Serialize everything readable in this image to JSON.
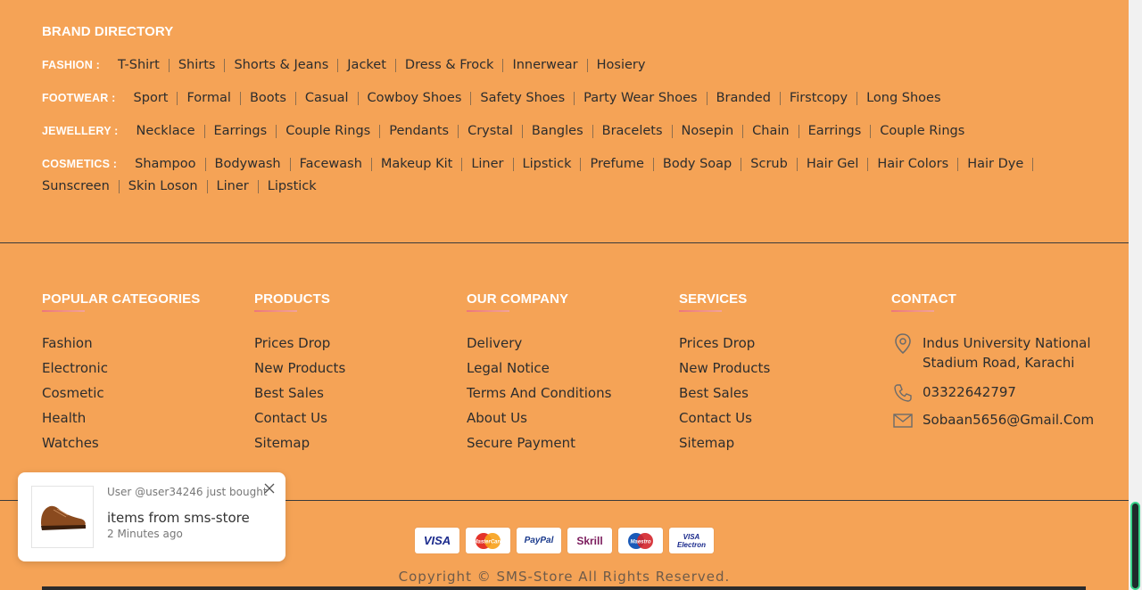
{
  "brand_directory": {
    "title": "BRAND DIRECTORY",
    "rows": [
      {
        "label": "FASHION :",
        "links": [
          "T-Shirt",
          "Shirts",
          "Shorts & Jeans",
          "Jacket",
          "Dress & Frock",
          "Innerwear",
          "Hosiery"
        ]
      },
      {
        "label": "FOOTWEAR :",
        "links": [
          "Sport",
          "Formal",
          "Boots",
          "Casual",
          "Cowboy Shoes",
          "Safety Shoes",
          "Party Wear Shoes",
          "Branded",
          "Firstcopy",
          "Long Shoes"
        ]
      },
      {
        "label": "JEWELLERY :",
        "links": [
          "Necklace",
          "Earrings",
          "Couple Rings",
          "Pendants",
          "Crystal",
          "Bangles",
          "Bracelets",
          "Nosepin",
          "Chain",
          "Earrings",
          "Couple Rings"
        ]
      },
      {
        "label": "COSMETICS :",
        "links": [
          "Shampoo",
          "Bodywash",
          "Facewash",
          "Makeup Kit",
          "Liner",
          "Lipstick",
          "Prefume",
          "Body Soap",
          "Scrub",
          "Hair Gel",
          "Hair Colors",
          "Hair Dye",
          "Sunscreen",
          "Skin Loson",
          "Liner",
          "Lipstick"
        ]
      }
    ]
  },
  "columns": [
    {
      "title": "POPULAR CATEGORIES",
      "items": [
        "Fashion",
        "Electronic",
        "Cosmetic",
        "Health",
        "Watches"
      ]
    },
    {
      "title": "PRODUCTS",
      "items": [
        "Prices Drop",
        "New Products",
        "Best Sales",
        "Contact Us",
        "Sitemap"
      ]
    },
    {
      "title": "OUR COMPANY",
      "items": [
        "Delivery",
        "Legal Notice",
        "Terms And Conditions",
        "About Us",
        "Secure Payment"
      ]
    },
    {
      "title": "SERVICES",
      "items": [
        "Prices Drop",
        "New Products",
        "Best Sales",
        "Contact Us",
        "Sitemap"
      ]
    }
  ],
  "contact": {
    "title": "CONTACT",
    "address_line1": "Indus University National",
    "address_line2": "Stadium Road, Karachi",
    "phone": "03322642797",
    "email": "Sobaan5656@Gmail.Com"
  },
  "payments": [
    {
      "name": "VISA",
      "color": "#1a2a8c"
    },
    {
      "name": "MasterCard",
      "color": "#e4332a"
    },
    {
      "name": "PayPal",
      "color": "#1a3a8c"
    },
    {
      "name": "Skrill",
      "color": "#7a1a5c"
    },
    {
      "name": "Maestro",
      "color": "#d4232a"
    },
    {
      "name": "VISA Electron",
      "color": "#1a2a8c"
    }
  ],
  "copyright": "Copyright © SMS-Store All Rights Reserved.",
  "toast": {
    "user": "User @user34246 just bought",
    "message": "items from sms-store",
    "time": "2 Minutes ago"
  },
  "colors": {
    "background": "#f5a356",
    "accent_white": "#ffffff",
    "text": "#2d2d2d"
  }
}
